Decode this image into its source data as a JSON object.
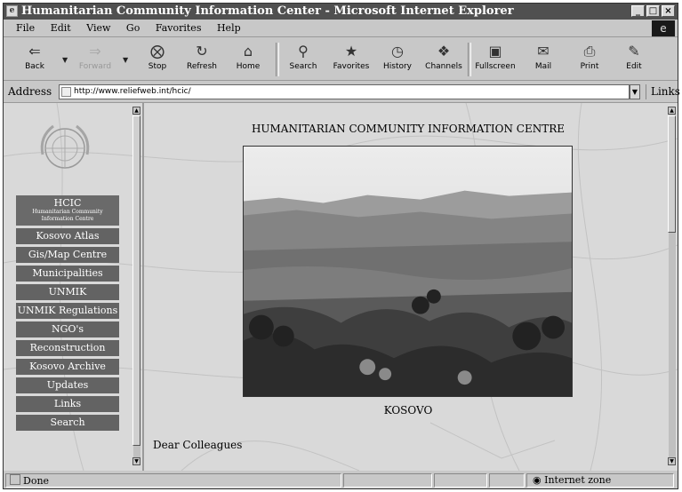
{
  "window": {
    "title": "Humanitarian Community Information Center - Microsoft Internet Explorer",
    "controls": [
      "_",
      "□",
      "×"
    ]
  },
  "menu": [
    "File",
    "Edit",
    "View",
    "Go",
    "Favorites",
    "Help"
  ],
  "toolbar": {
    "back": "Back",
    "forward": "Forward",
    "stop": "Stop",
    "refresh": "Refresh",
    "home": "Home",
    "search": "Search",
    "favorites": "Favorites",
    "history": "History",
    "channels": "Channels",
    "fullscreen": "Fullscreen",
    "mail": "Mail",
    "print": "Print",
    "edit": "Edit"
  },
  "address": {
    "label": "Address",
    "url": "http://www.reliefweb.int/hcic/",
    "links": "Links"
  },
  "sidebar": {
    "header_title": "HCIC",
    "header_subtitle": "Humanitarian Community Information Centre",
    "items": [
      {
        "label": "Kosovo Atlas"
      },
      {
        "label": "Gis/Map Centre"
      },
      {
        "label": "Municipalities"
      },
      {
        "label": "UNMIK"
      },
      {
        "label": "UNMIK Regulations"
      },
      {
        "label": "NGO's"
      },
      {
        "label": "Reconstruction"
      },
      {
        "label": "Kosovo Archive"
      },
      {
        "label": "Updates"
      },
      {
        "label": "Links"
      },
      {
        "label": "Search"
      }
    ]
  },
  "main": {
    "heading": "HUMANITARIAN COMMUNITY INFORMATION CENTRE",
    "caption": "KOSOVO",
    "greeting": "Dear Colleagues"
  },
  "status": {
    "left": "Done",
    "zone": "Internet zone"
  }
}
